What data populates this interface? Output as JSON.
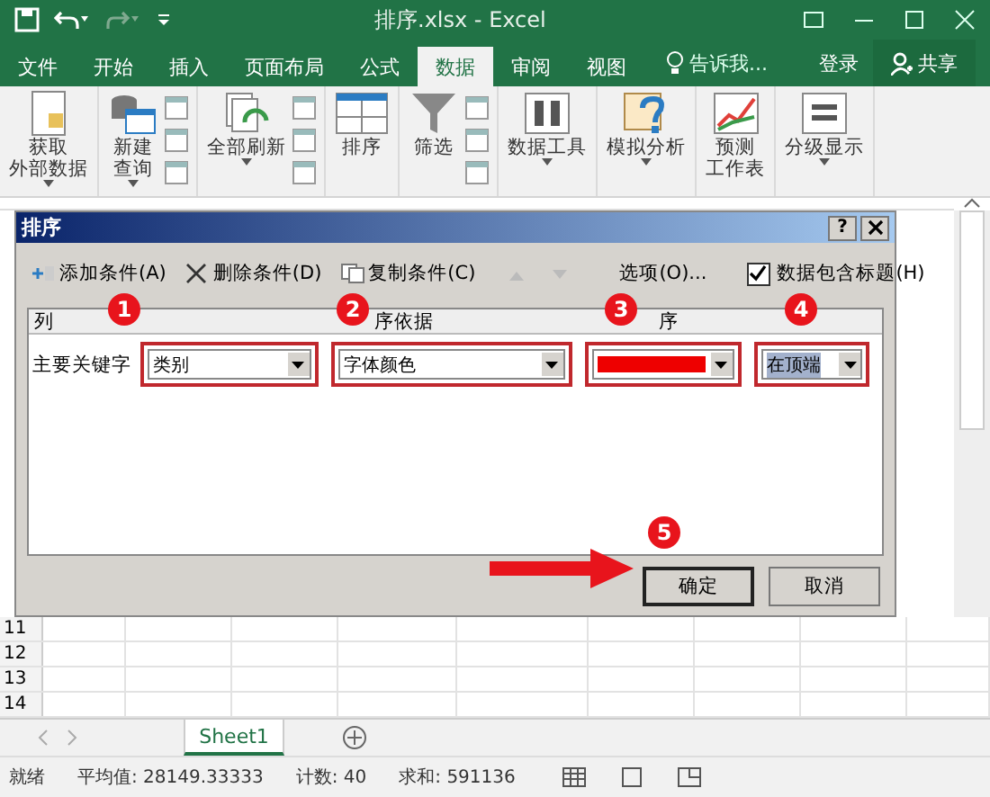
{
  "window": {
    "title": "排序.xlsx - Excel"
  },
  "tabs": [
    {
      "label": "文件",
      "selected": false
    },
    {
      "label": "开始",
      "selected": false
    },
    {
      "label": "插入",
      "selected": false
    },
    {
      "label": "页面布局",
      "selected": false
    },
    {
      "label": "公式",
      "selected": false
    },
    {
      "label": "数据",
      "selected": true
    },
    {
      "label": "审阅",
      "selected": false
    },
    {
      "label": "视图",
      "selected": false
    }
  ],
  "tell_me": "告诉我...",
  "sign_in": "登录",
  "share": "共享",
  "ribbon": [
    {
      "kind": "get",
      "lines": [
        "获取",
        "外部数据"
      ],
      "dropdown": true
    },
    {
      "kind": "query",
      "lines": [
        "新建",
        "查询"
      ],
      "dropdown": true
    },
    {
      "kind": "refresh",
      "lines": [
        "全部刷新"
      ],
      "dropdown": true
    },
    {
      "kind": "sort",
      "lines": [
        "排序"
      ],
      "dropdown": false
    },
    {
      "kind": "filter",
      "lines": [
        "筛选"
      ],
      "dropdown": false
    },
    {
      "kind": "tools",
      "lines": [
        "数据工具"
      ],
      "dropdown": true
    },
    {
      "kind": "whatif",
      "lines": [
        "模拟分析"
      ],
      "dropdown": true
    },
    {
      "kind": "forecast",
      "lines": [
        "预测",
        "工作表"
      ],
      "dropdown": false
    },
    {
      "kind": "outline",
      "lines": [
        "分级显示"
      ],
      "dropdown": true
    }
  ],
  "dialog": {
    "title": "排序",
    "help": "?",
    "toolbar": [
      {
        "kind": "add",
        "label": "添加条件(A)",
        "disabled": false
      },
      {
        "kind": "delete",
        "label": "删除条件(D)",
        "disabled": false
      },
      {
        "kind": "copy",
        "label": "复制条件(C)",
        "disabled": false
      },
      {
        "kind": "up",
        "disabled": true
      },
      {
        "kind": "down",
        "disabled": true
      }
    ],
    "options": "选项(O)...",
    "has_header": {
      "label": "数据包含标题(H)",
      "checked": true
    },
    "columns": [
      "列",
      "序依据",
      "序"
    ],
    "row": {
      "label": "主要关键字",
      "column": "类别",
      "sort_on": "字体颜色",
      "order": {
        "color": "#ee0000"
      },
      "position": "在顶端"
    },
    "buttons": [
      "确定",
      "取消"
    ]
  },
  "annotations": [
    {
      "label": "1"
    },
    {
      "label": "2"
    },
    {
      "label": "3"
    },
    {
      "label": "4"
    },
    {
      "label": "5"
    }
  ],
  "rows": [
    "11",
    "12",
    "13",
    "14"
  ],
  "sheet_tabs": [
    {
      "label": "Sheet1",
      "selected": true
    }
  ],
  "status": {
    "ready": "就绪",
    "stats": [
      "平均值: 28149.33333",
      "计数: 40",
      "求和: 591136"
    ]
  }
}
